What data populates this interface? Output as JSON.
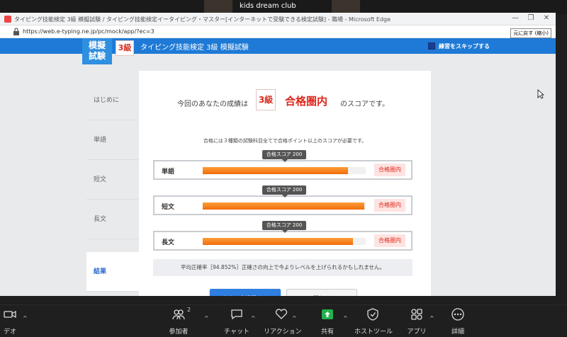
{
  "zoom_top": {
    "participant_name": "kids dream club"
  },
  "browser": {
    "title": "タイピング技能検定 3級 模擬試験 / タイピング技能検定イータイピング・マスター[インターネットで受験できる検定試験] - 職場 - Microsoft Edge",
    "url": "https://web.e-typing.ne.jp/pc/mock/app/?ec=3",
    "restore_tooltip": "元に戻す (縮小)",
    "controls": {
      "minimize": "—",
      "restore": "❐",
      "close": "✕"
    }
  },
  "header": {
    "logo_line1": "模擬",
    "logo_line2": "試験",
    "grade_badge": "3級",
    "title": "タイピング技能検定 3級 模擬試験",
    "skip_label": "練習をスキップする"
  },
  "sidebar": {
    "items": [
      {
        "label": "はじめに"
      },
      {
        "label": "単語"
      },
      {
        "label": "短文"
      },
      {
        "label": "長文"
      },
      {
        "label": "結果"
      }
    ]
  },
  "result": {
    "score_prefix": "今回のあなたの成績は",
    "grade_badge": "3級",
    "result_text": "合格圏内",
    "score_suffix": "のスコアです。",
    "note": "合格には３種類の試験科目全てで合格ポイント以上のスコアが必要です。",
    "threshold_label": "合格スコア 200",
    "rows": [
      {
        "label": "単語",
        "result": "合格圏内",
        "progress": 0.89
      },
      {
        "label": "短文",
        "result": "合格圏内",
        "progress": 0.99
      },
      {
        "label": "長文",
        "result": "合格圏内",
        "progress": 0.92
      }
    ],
    "average_text": "平均正確率［94.852%］正確さの向上で今よりレベルを上げられるかもしれません。",
    "retry_label": "もう一度挑戦する",
    "close_label": "閉じる"
  },
  "zoom_toolbar": {
    "video_label": "デオ",
    "participants_label": "参加者",
    "participants_count": "2",
    "chat_label": "チャット",
    "reaction_label": "リアクション",
    "share_label": "共有",
    "host_tools_label": "ホストツール",
    "apps_label": "アプリ",
    "more_label": "詳細",
    "colors": {
      "share": "#22b14c",
      "accent": "#1e7ad6"
    }
  }
}
